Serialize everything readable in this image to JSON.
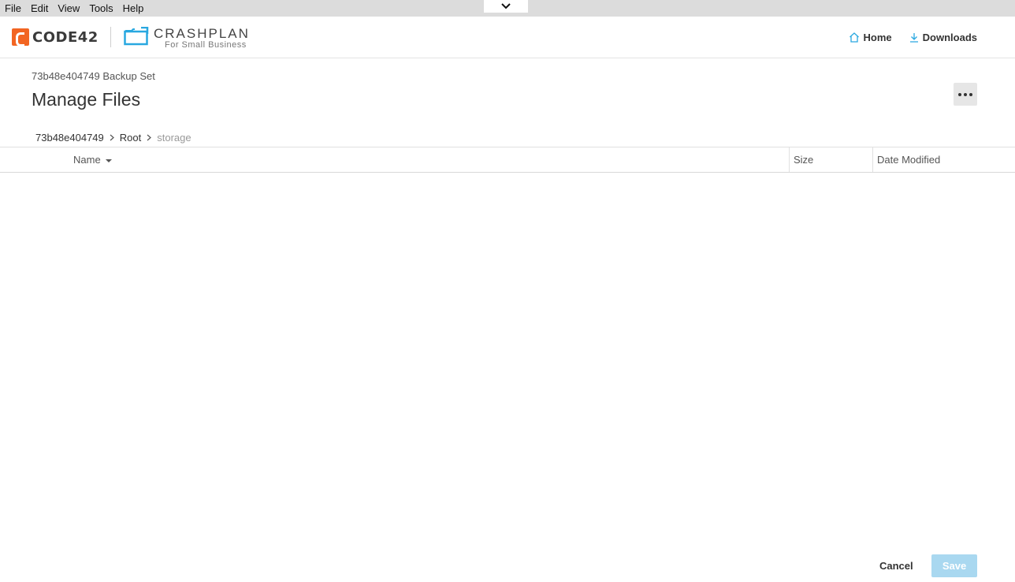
{
  "menubar": {
    "items": [
      "File",
      "Edit",
      "View",
      "Tools",
      "Help"
    ]
  },
  "header": {
    "brand_primary": "CODE42",
    "brand_secondary_title": "CRASHPLAN",
    "brand_secondary_sub": "For Small Business",
    "nav": {
      "home_label": "Home",
      "downloads_label": "Downloads"
    }
  },
  "page": {
    "subtitle": "73b48e404749 Backup Set",
    "title": "Manage Files"
  },
  "breadcrumb": {
    "items": [
      "73b48e404749",
      "Root",
      "storage"
    ]
  },
  "table": {
    "columns": {
      "name": "Name",
      "size": "Size",
      "date_modified": "Date Modified"
    },
    "rows": []
  },
  "footer": {
    "cancel_label": "Cancel",
    "save_label": "Save"
  },
  "colors": {
    "brand_orange": "#f26522",
    "brand_blue": "#29a8e0",
    "save_disabled": "#a9d8f0"
  }
}
